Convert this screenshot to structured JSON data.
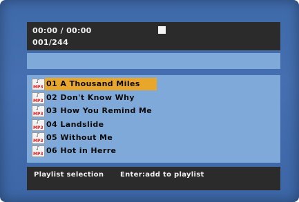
{
  "status": {
    "time": "00:00  /  00:00",
    "track_counter": "001/244",
    "play_state_icon": "stop-icon"
  },
  "playlist": {
    "items": [
      {
        "label": "01  A  Thousand  Miles",
        "icon": "mp3-file-icon",
        "selected": true
      },
      {
        "label": "02  Don't  Know  Why",
        "icon": "mp3-file-icon",
        "selected": false
      },
      {
        "label": "03  How  You  Remind  Me",
        "icon": "mp3-file-icon",
        "selected": false
      },
      {
        "label": "04  Landslide",
        "icon": "mp3-file-icon",
        "selected": false
      },
      {
        "label": "05  Without  Me",
        "icon": "mp3-file-icon",
        "selected": false
      },
      {
        "label": "06  Hot  in  Herre",
        "icon": "mp3-file-icon",
        "selected": false
      }
    ],
    "icon_text": "MP3",
    "highlight_color": "#e8a72a"
  },
  "help": {
    "left": "Playlist  selection",
    "right": "Enter:add  to  playlist"
  },
  "colors": {
    "background": "#456fb0",
    "panel": "#7ea9d8",
    "bar": "#2b2b2b"
  }
}
